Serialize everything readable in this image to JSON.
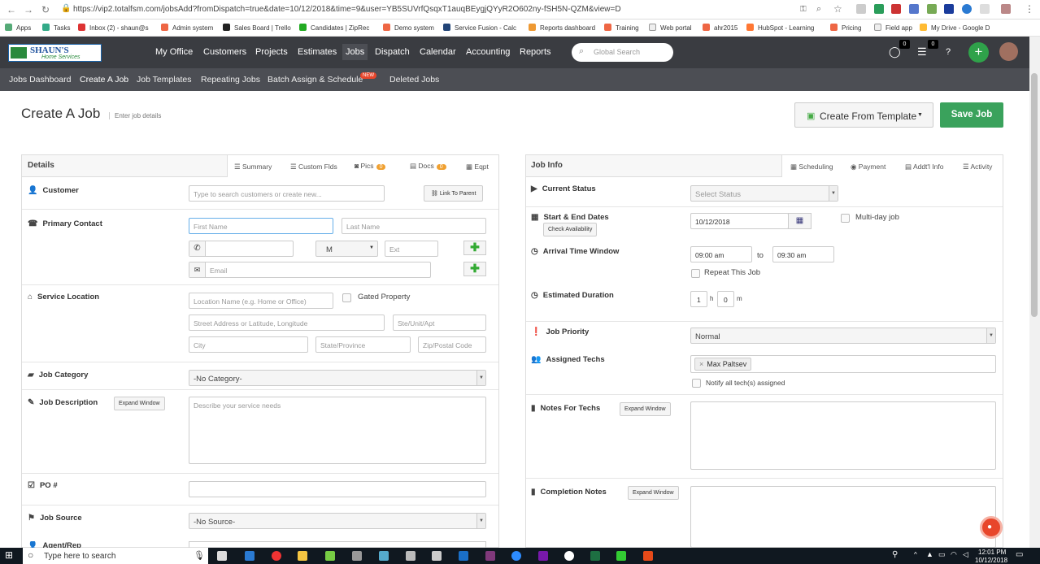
{
  "browser": {
    "url": "https://vip2.totalfsm.com/jobsAdd?fromDispatch=true&date=10/12/2018&time=9&user=YB5SUVrfQsqxT1auqBEygjQYyR2O602ny-fSH5N-QZM&view=D",
    "bookmarks": [
      "Apps",
      "Tasks",
      "Inbox (2) - shaun@s",
      "Admin system",
      "Sales Board | Trello",
      "Candidates | ZipRec",
      "Demo system",
      "Service Fusion - Calc",
      "Reports dashboard",
      "Training",
      "Web portal",
      "ahr2015",
      "HubSpot - Learning",
      "Pricing",
      "Field app",
      "My Drive - Google D"
    ]
  },
  "logo": {
    "line1": "SHAUN'S",
    "line2": "Home Services"
  },
  "nav": {
    "items": [
      "My Office",
      "Customers",
      "Projects",
      "Estimates",
      "Jobs",
      "Dispatch",
      "Calendar",
      "Accounting",
      "Reports"
    ],
    "search_placeholder": "Global Search",
    "chat_count": "0",
    "list_count": "0",
    "help": "?",
    "add": "+"
  },
  "subnav": {
    "items": [
      "Jobs Dashboard",
      "Create A Job",
      "Job Templates",
      "Repeating Jobs",
      "Batch Assign & Schedule",
      "Deleted Jobs"
    ],
    "new_badge": "NEW"
  },
  "page": {
    "title": "Create A Job",
    "subtitle": "Enter job details",
    "create_from_template": "Create From Template",
    "save_job": "Save Job"
  },
  "details": {
    "title": "Details",
    "tabs": [
      {
        "label": "Summary"
      },
      {
        "label": "Custom Flds"
      },
      {
        "label": "Pics",
        "count": "0"
      },
      {
        "label": "Docs",
        "count": "0"
      },
      {
        "label": "Eqpt"
      }
    ],
    "customer_label": "Customer",
    "customer_placeholder": "Type to search customers or create new...",
    "link_to_parent": "Link To Parent",
    "primary_contact_label": "Primary Contact",
    "first_name_placeholder": "First Name",
    "last_name_placeholder": "Last Name",
    "phone_type": "M",
    "ext_placeholder": "Ext",
    "email_placeholder": "Email",
    "service_location_label": "Service Location",
    "location_name_placeholder": "Location Name (e.g. Home or Office)",
    "gated_property": "Gated Property",
    "street_placeholder": "Street Address or Latitude, Longitude",
    "ste_placeholder": "Ste/Unit/Apt",
    "city_placeholder": "City",
    "state_placeholder": "State/Province",
    "zip_placeholder": "Zip/Postal Code",
    "job_category_label": "Job Category",
    "job_category_value": "-No Category-",
    "job_description_label": "Job Description",
    "expand_window": "Expand Window",
    "description_placeholder": "Describe your service needs",
    "po_label": "PO #",
    "job_source_label": "Job Source",
    "job_source_value": "-No Source-",
    "agent_label": "Agent/Rep"
  },
  "jobinfo": {
    "title": "Job Info",
    "tabs": [
      "Scheduling",
      "Payment",
      "Addt'l Info",
      "Activity"
    ],
    "current_status_label": "Current Status",
    "status_placeholder": "Select Status",
    "dates_label": "Start & End Dates",
    "check_availability": "Check Availability",
    "start_date": "10/12/2018",
    "multiday": "Multi-day job",
    "arrival_label": "Arrival Time Window",
    "arrival_from": "09:00 am",
    "to": "to",
    "arrival_to": "09:30 am",
    "repeat": "Repeat This Job",
    "duration_label": "Estimated Duration",
    "hours": "1",
    "h": "h",
    "minutes": "0",
    "m": "m",
    "priority_label": "Job Priority",
    "priority_value": "Normal",
    "techs_label": "Assigned Techs",
    "tech": "Max Paltsev",
    "notify": "Notify all tech(s) assigned",
    "notes_label": "Notes For Techs",
    "completion_label": "Completion Notes",
    "expand_window": "Expand Window"
  },
  "taskbar": {
    "search": "Type here to search",
    "time": "12:01 PM",
    "date": "10/12/2018"
  },
  "colors": {
    "nav_bg": "#3a3c41",
    "subnav_bg": "#4c4e54",
    "save": "#3aa25c",
    "badge": "#f0a030",
    "new": "#e8462b"
  }
}
